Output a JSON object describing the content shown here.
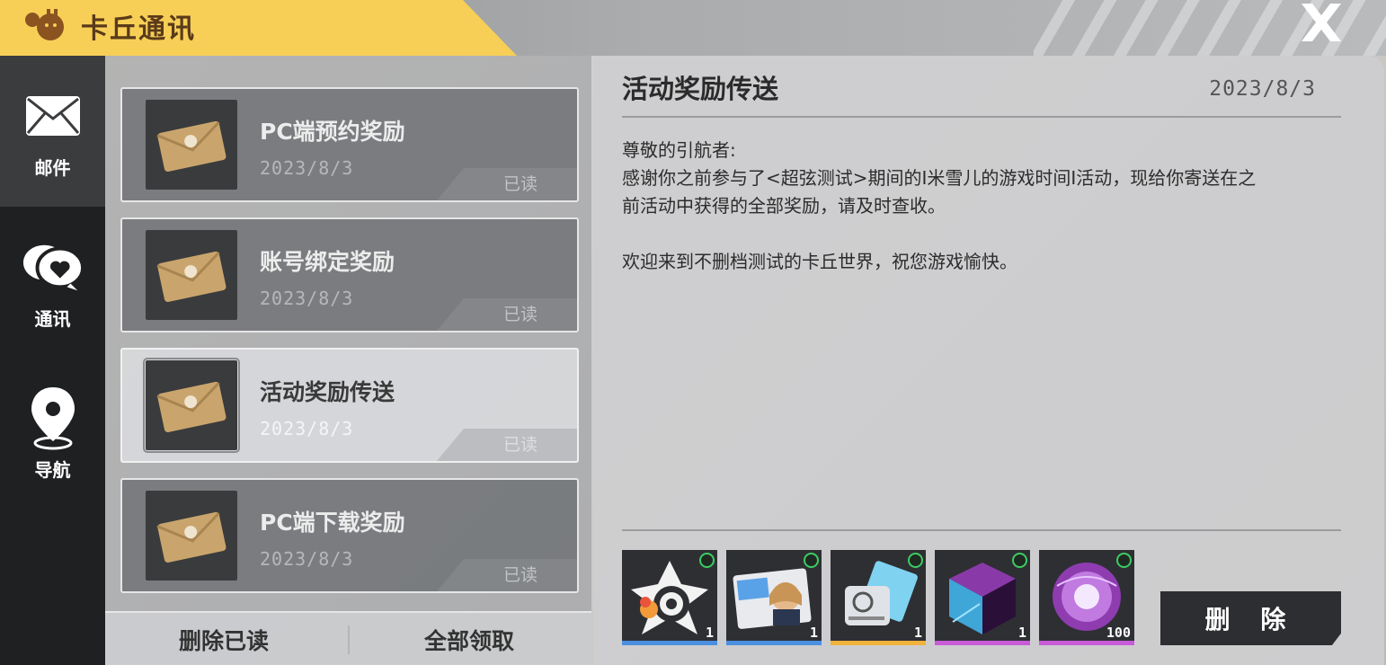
{
  "header": {
    "title": "卡丘通讯",
    "logo_icon": "mascot-logo-icon",
    "close_icon": "close-x-icon"
  },
  "sidebar": {
    "items": [
      {
        "label": "邮件",
        "icon": "envelope-icon",
        "active": true
      },
      {
        "label": "通讯",
        "icon": "chat-heart-icon",
        "active": false
      },
      {
        "label": "导航",
        "icon": "map-pin-icon",
        "active": false
      }
    ]
  },
  "mail_list": {
    "items": [
      {
        "title": "PC端预约奖励",
        "date": "2023/8/3",
        "status": "已读",
        "selected": false
      },
      {
        "title": "账号绑定奖励",
        "date": "2023/8/3",
        "status": "已读",
        "selected": false
      },
      {
        "title": "活动奖励传送",
        "date": "2023/8/3",
        "status": "已读",
        "selected": true
      },
      {
        "title": "PC端下载奖励",
        "date": "2023/8/3",
        "status": "已读",
        "selected": false
      }
    ],
    "footer": {
      "delete_read_label": "删除已读",
      "claim_all_label": "全部领取"
    }
  },
  "detail": {
    "title": "活动奖励传送",
    "date": "2023/8/3",
    "body": {
      "greeting": "尊敬的引航者:",
      "line1": "感谢你之前参与了<超弦测试>期间的I米雪儿的游戏时间I活动，现给你寄送在之",
      "line2": "前活动中获得的全部奖励，请及时查收。",
      "line3": "欢迎来到不删档测试的卡丘世界，祝您游戏愉快。"
    },
    "rewards": [
      {
        "icon": "target-badge-icon",
        "qty": "1",
        "rarity_color": "#4a8fe0",
        "claimed": true
      },
      {
        "icon": "character-card-icon",
        "qty": "1",
        "rarity_color": "#4a8fe0",
        "claimed": true
      },
      {
        "icon": "device-chip-icon",
        "qty": "1",
        "rarity_color": "#f0b23c",
        "claimed": true
      },
      {
        "icon": "purple-cube-icon",
        "qty": "1",
        "rarity_color": "#c75bd8",
        "claimed": true
      },
      {
        "icon": "purple-orb-icon",
        "qty": "100",
        "rarity_color": "#c75bd8",
        "claimed": true
      }
    ],
    "delete_label": "删 除"
  }
}
